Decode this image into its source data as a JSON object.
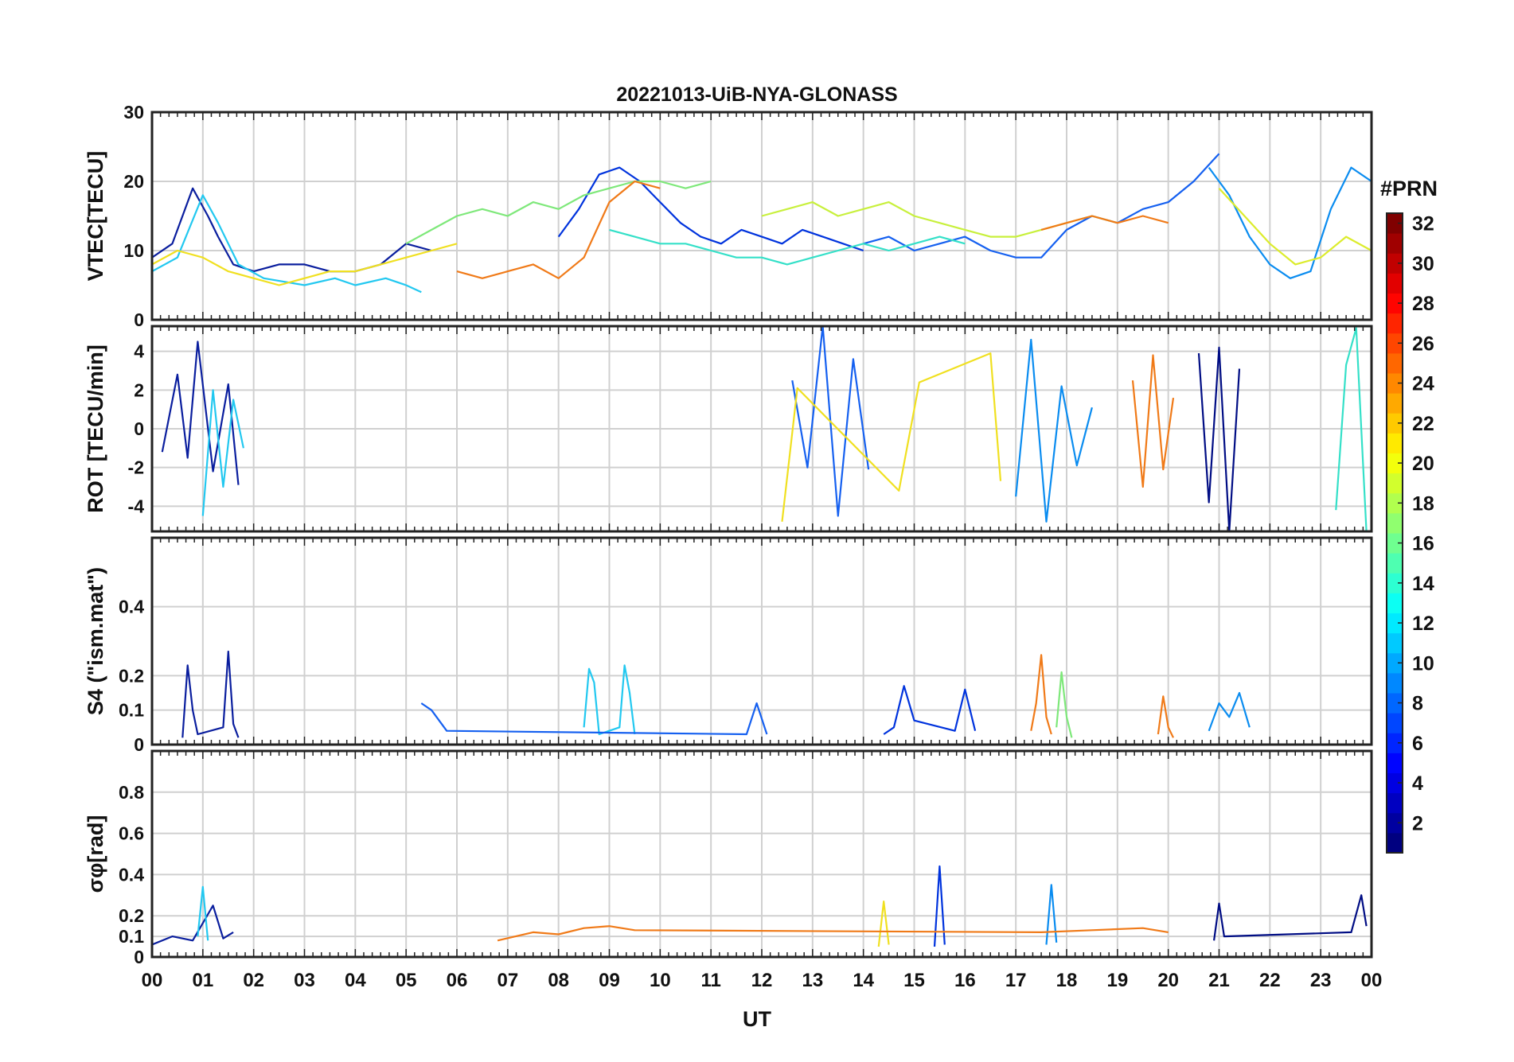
{
  "title": "20221013-UiB-NYA-GLONASS",
  "colorbar": {
    "label": "#PRN",
    "ticks": [
      "2",
      "4",
      "6",
      "8",
      "10",
      "12",
      "14",
      "16",
      "18",
      "20",
      "22",
      "24",
      "26",
      "28",
      "30",
      "32"
    ],
    "range": [
      1,
      32
    ]
  },
  "x_axis": {
    "label": "UT",
    "ticks": [
      "00",
      "01",
      "02",
      "03",
      "04",
      "05",
      "06",
      "07",
      "08",
      "09",
      "10",
      "11",
      "12",
      "13",
      "14",
      "15",
      "16",
      "17",
      "18",
      "19",
      "20",
      "21",
      "22",
      "23",
      "00"
    ],
    "range_hours": [
      0,
      24
    ]
  },
  "chart_data": [
    {
      "type": "line",
      "ylabel": "VTEC[TECU]",
      "ylim": [
        0,
        30
      ],
      "yticks": [
        "0",
        "10",
        "20",
        "30"
      ],
      "series": [
        {
          "prn": 2,
          "color": "#0a1e9e",
          "x": [
            0.0,
            0.4,
            0.8,
            1.1,
            1.3,
            1.6,
            2.0,
            2.5,
            3.0,
            3.5,
            4.0,
            4.5,
            5.0,
            5.5
          ],
          "y": [
            9,
            11,
            19,
            15,
            12,
            8,
            7,
            8,
            8,
            7,
            7,
            8,
            11,
            10
          ]
        },
        {
          "prn": 4,
          "color": "#0033dd",
          "x": [
            8.0,
            8.4,
            8.8,
            9.2,
            9.6,
            10.0,
            10.4,
            10.8,
            11.2,
            11.6,
            12.0,
            12.4,
            12.8,
            13.2,
            13.6,
            14.0
          ],
          "y": [
            12,
            16,
            21,
            22,
            20,
            17,
            14,
            12,
            11,
            13,
            12,
            11,
            13,
            12,
            11,
            10
          ]
        },
        {
          "prn": 6,
          "color": "#1560f0",
          "x": [
            14.0,
            14.5,
            15.0,
            15.5,
            16.0,
            16.5,
            17.0,
            17.5,
            18.0,
            18.5,
            19.0,
            19.5,
            20.0,
            20.5,
            21.0
          ],
          "y": [
            11,
            12,
            10,
            11,
            12,
            10,
            9,
            9,
            13,
            15,
            14,
            16,
            17,
            20,
            24
          ]
        },
        {
          "prn": 8,
          "color": "#0a8cf0",
          "x": [
            20.8,
            21.2,
            21.6,
            22.0,
            22.4,
            22.8,
            23.2,
            23.6,
            24.0
          ],
          "y": [
            22,
            18,
            12,
            8,
            6,
            7,
            16,
            22,
            20
          ]
        },
        {
          "prn": 12,
          "color": "#22c8f0",
          "x": [
            0.0,
            0.5,
            1.0,
            1.3,
            1.7,
            2.2,
            3.0,
            3.6,
            4.0,
            4.6,
            5.0,
            5.3
          ],
          "y": [
            7,
            9,
            18,
            14,
            8,
            6,
            5,
            6,
            5,
            6,
            5,
            4
          ]
        },
        {
          "prn": 14,
          "color": "#34e0c8",
          "x": [
            9.0,
            9.5,
            10.0,
            10.5,
            11.0,
            11.5,
            12.0,
            12.5,
            13.0,
            13.5,
            14.0,
            14.5,
            15.0,
            15.5,
            16.0
          ],
          "y": [
            13,
            12,
            11,
            11,
            10,
            9,
            9,
            8,
            9,
            10,
            11,
            10,
            11,
            12,
            11
          ]
        },
        {
          "prn": 16,
          "color": "#7ee87a",
          "x": [
            5.0,
            5.5,
            6.0,
            6.5,
            7.0,
            7.5,
            8.0,
            8.5,
            9.0,
            9.5,
            10.0,
            10.5,
            11.0
          ],
          "y": [
            11,
            13,
            15,
            16,
            15,
            17,
            16,
            18,
            19,
            20,
            20,
            19,
            20
          ]
        },
        {
          "prn": 18,
          "color": "#c8f03c",
          "x": [
            12.0,
            12.5,
            13.0,
            13.5,
            14.0,
            14.5,
            15.0,
            15.5,
            16.0,
            16.5,
            17.0,
            17.5,
            18.0,
            18.5,
            19.0
          ],
          "y": [
            15,
            16,
            17,
            15,
            16,
            17,
            15,
            14,
            13,
            12,
            12,
            13,
            14,
            15,
            14
          ]
        },
        {
          "prn": 20,
          "color": "#f0e020",
          "x": [
            0.0,
            0.5,
            1.0,
            1.5,
            2.0,
            2.5,
            3.0,
            3.5,
            4.0,
            4.5,
            5.0,
            5.5,
            6.0
          ],
          "y": [
            8,
            10,
            9,
            7,
            6,
            5,
            6,
            7,
            7,
            8,
            9,
            10,
            11
          ]
        },
        {
          "prn": 23,
          "color": "#f07a18",
          "x": [
            6.0,
            6.5,
            7.0,
            7.5,
            8.0,
            8.5,
            9.0,
            9.5,
            10.0
          ],
          "y": [
            7,
            6,
            7,
            8,
            6,
            9,
            17,
            20,
            19
          ]
        },
        {
          "prn": 23,
          "color": "#f07a18",
          "x": [
            17.5,
            18.0,
            18.5,
            19.0,
            19.5,
            20.0
          ],
          "y": [
            13,
            14,
            15,
            14,
            15,
            14
          ]
        },
        {
          "prn": 19,
          "color": "#dcec2c",
          "x": [
            21.0,
            21.5,
            22.0,
            22.5,
            23.0,
            23.5,
            24.0
          ],
          "y": [
            19,
            15,
            11,
            8,
            9,
            12,
            10
          ]
        }
      ]
    },
    {
      "type": "line",
      "ylabel": "ROT [TECU/min]",
      "ylim": [
        -5.3,
        5.3
      ],
      "yticks": [
        "-4",
        "-2",
        "0",
        "2",
        "4"
      ],
      "series": [
        {
          "prn": 2,
          "color": "#0a1e9e",
          "x": [
            0.2,
            0.5,
            0.7,
            0.9,
            1.2,
            1.5,
            1.7
          ],
          "y": [
            -1.2,
            2.8,
            -1.5,
            4.5,
            -2.2,
            2.3,
            -2.9
          ]
        },
        {
          "prn": 6,
          "color": "#1560f0",
          "x": [
            12.6,
            12.9,
            13.2,
            13.5,
            13.8,
            14.1
          ],
          "y": [
            2.5,
            -2.0,
            5.3,
            -4.5,
            3.6,
            -2.1
          ]
        },
        {
          "prn": 8,
          "color": "#0a8cf0",
          "x": [
            17.0,
            17.3,
            17.6,
            17.9,
            18.2,
            18.5
          ],
          "y": [
            -3.5,
            4.6,
            -4.8,
            2.2,
            -1.9,
            1.1
          ]
        },
        {
          "prn": 12,
          "color": "#22c8f0",
          "x": [
            1.0,
            1.2,
            1.4,
            1.6,
            1.8
          ],
          "y": [
            -4.5,
            2.0,
            -3.0,
            1.5,
            -1.0
          ]
        },
        {
          "prn": 14,
          "color": "#34e0c8",
          "x": [
            23.3,
            23.5,
            23.7,
            23.9
          ],
          "y": [
            -4.2,
            3.3,
            5.2,
            -5.3
          ]
        },
        {
          "prn": 20,
          "color": "#f0e020",
          "x": [
            12.4,
            12.7,
            14.7,
            15.1,
            16.5,
            16.7
          ],
          "y": [
            -4.8,
            2.1,
            -3.2,
            2.4,
            3.9,
            -2.7
          ]
        },
        {
          "prn": 23,
          "color": "#f07a18",
          "x": [
            19.3,
            19.5,
            19.7,
            19.9,
            20.1
          ],
          "y": [
            2.5,
            -3.0,
            3.8,
            -2.1,
            1.6
          ]
        },
        {
          "prn": 1,
          "color": "#000d84",
          "x": [
            20.6,
            20.8,
            21.0,
            21.2,
            21.4
          ],
          "y": [
            3.9,
            -3.8,
            4.2,
            -5.3,
            3.1
          ]
        }
      ]
    },
    {
      "type": "line",
      "ylabel": "S4 (\"ism.mat\")",
      "ylim": [
        0,
        0.6
      ],
      "yticks": [
        "0",
        "0.1",
        "0.2",
        "0.4"
      ],
      "series": [
        {
          "prn": 2,
          "color": "#0a1e9e",
          "x": [
            0.6,
            0.7,
            0.8,
            0.9,
            1.4,
            1.5,
            1.6,
            1.7
          ],
          "y": [
            0.02,
            0.23,
            0.1,
            0.03,
            0.05,
            0.27,
            0.06,
            0.02
          ]
        },
        {
          "prn": 12,
          "color": "#22c8f0",
          "x": [
            8.5,
            8.6,
            8.7,
            8.8,
            9.2,
            9.3,
            9.4,
            9.5
          ],
          "y": [
            0.05,
            0.22,
            0.18,
            0.03,
            0.05,
            0.23,
            0.15,
            0.03
          ]
        },
        {
          "prn": 23,
          "color": "#f07a18",
          "x": [
            17.3,
            17.4,
            17.5,
            17.6,
            17.7
          ],
          "y": [
            0.04,
            0.12,
            0.26,
            0.08,
            0.03
          ]
        },
        {
          "prn": 16,
          "color": "#7ee87a",
          "x": [
            17.8,
            17.9,
            18.0,
            18.1
          ],
          "y": [
            0.05,
            0.21,
            0.08,
            0.02
          ]
        },
        {
          "prn": 4,
          "color": "#0033dd",
          "x": [
            14.4,
            14.6,
            14.8,
            15.0,
            15.8,
            16.0,
            16.2
          ],
          "y": [
            0.03,
            0.05,
            0.17,
            0.07,
            0.04,
            0.16,
            0.04
          ]
        },
        {
          "prn": 8,
          "color": "#0a8cf0",
          "x": [
            20.8,
            21.0,
            21.2,
            21.4,
            21.6
          ],
          "y": [
            0.04,
            0.12,
            0.08,
            0.15,
            0.05
          ]
        },
        {
          "prn": 23,
          "color": "#f07a18",
          "x": [
            19.8,
            19.9,
            20.0,
            20.1
          ],
          "y": [
            0.03,
            0.14,
            0.05,
            0.02
          ]
        },
        {
          "prn": 6,
          "color": "#1560f0",
          "x": [
            5.3,
            5.5,
            5.8,
            11.7,
            11.9,
            12.1
          ],
          "y": [
            0.12,
            0.1,
            0.04,
            0.03,
            0.12,
            0.03
          ]
        }
      ]
    },
    {
      "type": "line",
      "ylabel": "σφ[rad]",
      "ylim": [
        0,
        1.0
      ],
      "yticks": [
        "0",
        "0.1",
        "0.2",
        "0.4",
        "0.6",
        "0.8"
      ],
      "series": [
        {
          "prn": 2,
          "color": "#0a1e9e",
          "x": [
            0.0,
            0.4,
            0.8,
            1.2,
            1.4,
            1.6
          ],
          "y": [
            0.06,
            0.1,
            0.08,
            0.25,
            0.09,
            0.12
          ]
        },
        {
          "prn": 12,
          "color": "#22c8f0",
          "x": [
            0.9,
            1.0,
            1.1
          ],
          "y": [
            0.1,
            0.34,
            0.08
          ]
        },
        {
          "prn": 4,
          "color": "#0033dd",
          "x": [
            15.4,
            15.5,
            15.6
          ],
          "y": [
            0.05,
            0.44,
            0.06
          ]
        },
        {
          "prn": 8,
          "color": "#0a8cf0",
          "x": [
            17.6,
            17.7,
            17.8
          ],
          "y": [
            0.06,
            0.35,
            0.07
          ]
        },
        {
          "prn": 20,
          "color": "#f0e020",
          "x": [
            14.3,
            14.4,
            14.5
          ],
          "y": [
            0.05,
            0.27,
            0.06
          ]
        },
        {
          "prn": 1,
          "color": "#000d84",
          "x": [
            20.9,
            21.0,
            21.1,
            23.6,
            23.8,
            23.9
          ],
          "y": [
            0.08,
            0.26,
            0.1,
            0.12,
            0.3,
            0.15
          ]
        },
        {
          "prn": 23,
          "color": "#f07a18",
          "x": [
            6.8,
            7.5,
            8.0,
            8.5,
            9.0,
            9.5,
            17.5,
            18.5,
            19.5,
            20.0
          ],
          "y": [
            0.08,
            0.12,
            0.11,
            0.14,
            0.15,
            0.13,
            0.12,
            0.13,
            0.14,
            0.12
          ]
        }
      ]
    }
  ]
}
